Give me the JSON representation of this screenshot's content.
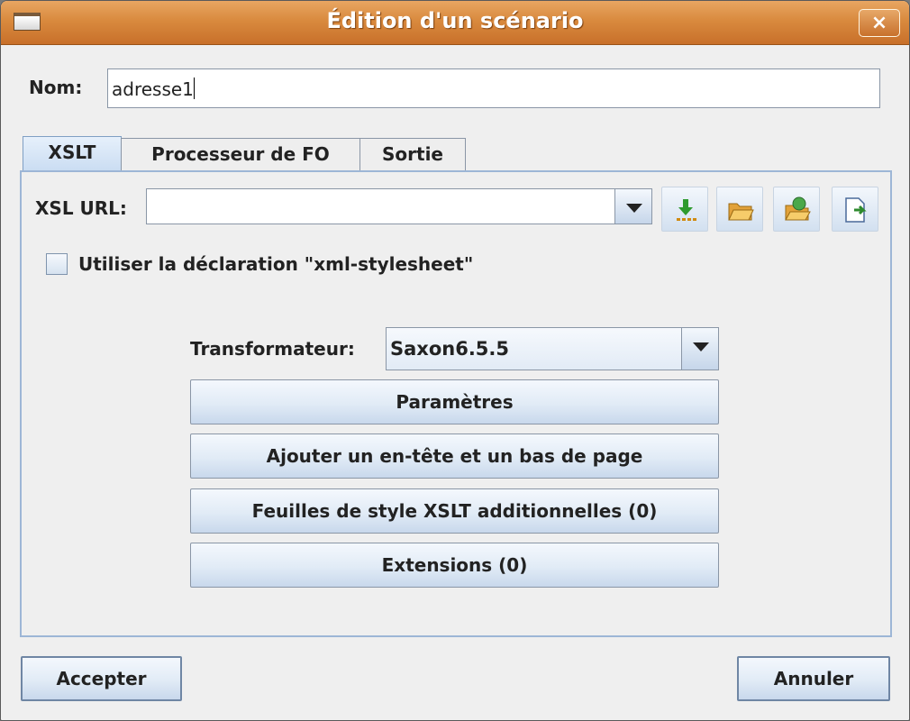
{
  "window": {
    "title": "Édition d'un scénario",
    "close_label": "×"
  },
  "name": {
    "label": "Nom:",
    "value": "adresse1"
  },
  "tabs": [
    {
      "label": "XSLT",
      "active": true
    },
    {
      "label": "Processeur de FO",
      "active": false
    },
    {
      "label": "Sortie",
      "active": false
    }
  ],
  "xsl": {
    "label": "XSL URL:",
    "url_value": "",
    "toolbar_icons": [
      "insert-editor-variables-icon",
      "browse-local-icon",
      "browse-url-icon",
      "open-in-editor-icon"
    ]
  },
  "stylesheet_checkbox": {
    "label": "Utiliser la déclaration \"xml-stylesheet\"",
    "checked": false
  },
  "transformer": {
    "label": "Transformateur:",
    "value": "Saxon6.5.5"
  },
  "buttons": {
    "parameters": "Paramètres",
    "header_footer": "Ajouter un en-tête et un bas de page",
    "additional_xslt": "Feuilles de style XSLT additionnelles (0)",
    "extensions": "Extensions (0)"
  },
  "footer": {
    "accept": "Accepter",
    "cancel": "Annuler"
  },
  "colors": {
    "titlebar": "#d98a3e",
    "tab_border": "#9db6d6",
    "button_gradient_bottom": "#c8d8ec"
  }
}
